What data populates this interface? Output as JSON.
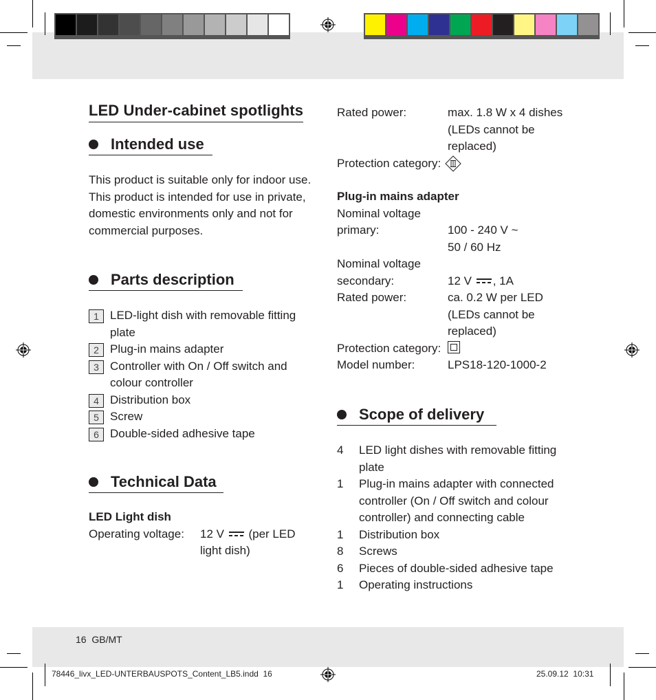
{
  "print_marks": {
    "grayscale_swatches": [
      "#000000",
      "#1c1c1c",
      "#333333",
      "#4d4d4d",
      "#666666",
      "#808080",
      "#999999",
      "#b3b3b3",
      "#cccccc",
      "#e6e6e6",
      "#ffffff"
    ],
    "color_swatches": [
      "#fff200",
      "#ec008c",
      "#00aeef",
      "#2e3192",
      "#00a651",
      "#ed1c24",
      "#231f20",
      "#fff685",
      "#f683c4",
      "#7dd3f7",
      "#939192"
    ]
  },
  "page": {
    "title": "LED Under-cabinet spotlights",
    "intended_use": {
      "heading": "Intended use",
      "text": "This product is suitable only for indoor use. This product is intended for use in private, domestic environments only and not for commercial purposes."
    },
    "parts_description": {
      "heading": "Parts description",
      "items": [
        {
          "num": "1",
          "label": "LED-light dish with removable fitting plate"
        },
        {
          "num": "2",
          "label": "Plug-in mains adapter"
        },
        {
          "num": "3",
          "label": "Controller with On / Off switch and colour controller"
        },
        {
          "num": "4",
          "label": "Distribution box"
        },
        {
          "num": "5",
          "label": "Screw"
        },
        {
          "num": "6",
          "label": "Double-sided adhesive tape"
        }
      ]
    },
    "technical_data": {
      "heading": "Technical Data",
      "led_dish": {
        "subheading": "LED Light dish",
        "operating_voltage_label": "Operating voltage:",
        "operating_voltage_value": "12 V",
        "operating_voltage_suffix": "(per LED light dish)",
        "rated_power_label": "Rated power:",
        "rated_power_value": "max. 1.8 W x 4 dishes (LEDs cannot be replaced)",
        "protection_label": "Protection category:",
        "protection_icon": "protection-class-III"
      },
      "adapter": {
        "subheading": "Plug-in mains adapter",
        "primary_label_1": "Nominal voltage",
        "primary_label_2": "primary:",
        "primary_value_1": "100 - 240 V ~",
        "primary_value_2": "50 / 60 Hz",
        "secondary_label_1": "Nominal voltage",
        "secondary_label_2": "secondary:",
        "secondary_value_prefix": "12 V",
        "secondary_value_suffix": ", 1A",
        "rated_power_label": "Rated power:",
        "rated_power_value": "ca. 0.2 W per LED (LEDs cannot be replaced)",
        "protection_label": "Protection category:",
        "protection_icon": "protection-class-II",
        "model_label": "Model number:",
        "model_value": "LPS18-120-1000-2"
      }
    },
    "scope_of_delivery": {
      "heading": "Scope of delivery",
      "items": [
        {
          "qty": "4",
          "label": "LED light dishes with removable fitting plate"
        },
        {
          "qty": "1",
          "label": "Plug-in mains adapter with connected controller (On / Off switch and colour controller) and connecting cable"
        },
        {
          "qty": "1",
          "label": "Distribution box"
        },
        {
          "qty": "8",
          "label": "Screws"
        },
        {
          "qty": "6",
          "label": "Pieces of double-sided adhesive tape"
        },
        {
          "qty": "1",
          "label": "Operating instructions"
        }
      ]
    },
    "footer": {
      "page_number": "16",
      "language": "GB/MT"
    }
  },
  "slug": {
    "filename": "78446_livx_LED-UNTERBAUSPOTS_Content_LB5.indd",
    "page": "16",
    "date": "25.09.12",
    "time": "10:31"
  }
}
